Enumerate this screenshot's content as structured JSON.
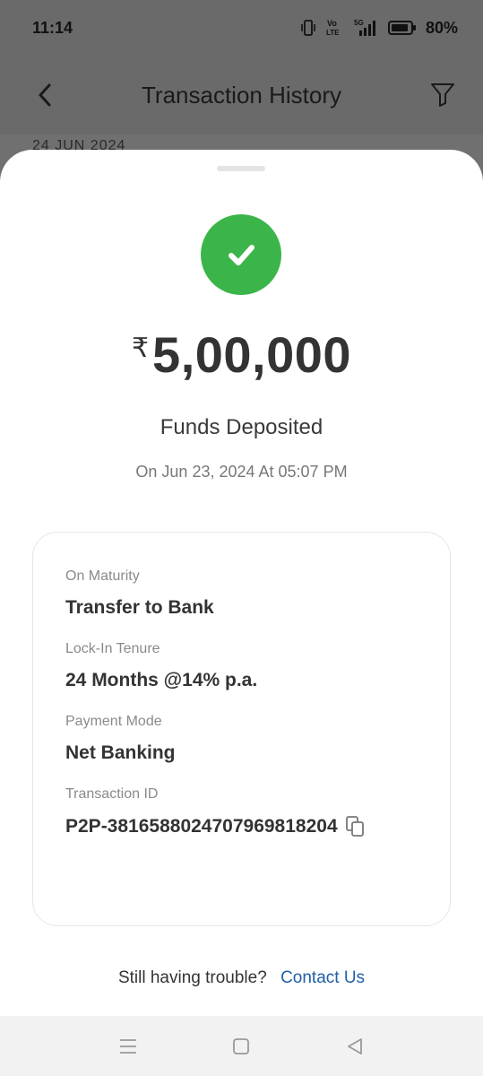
{
  "status_bar": {
    "time": "11:14",
    "battery": "80%",
    "icons": [
      "vibrate-icon",
      "volte-icon",
      "5g-signal-icon",
      "battery-icon"
    ]
  },
  "header": {
    "title": "Transaction History",
    "back_icon": "back-arrow-icon",
    "filter_icon": "filter-icon"
  },
  "list_peek": {
    "date": "24 JUN 2024"
  },
  "transaction": {
    "currency_symbol": "₹",
    "amount": "5,00,000",
    "status": "Funds Deposited",
    "date": "On Jun 23, 2024 At 05:07 PM",
    "status_color": "#3bb54a"
  },
  "details": [
    {
      "label": "On Maturity",
      "value": "Transfer to Bank"
    },
    {
      "label": "Lock-In Tenure",
      "value": "24 Months @14% p.a."
    },
    {
      "label": "Payment Mode",
      "value": "Net Banking"
    },
    {
      "label": "Transaction ID",
      "value": "P2P-381658802470796981820​4"
    }
  ],
  "help": {
    "prompt": "Still having trouble?",
    "link": "Contact Us",
    "link_color": "#1f5fa8"
  },
  "nav": {
    "icons": [
      "recents-icon",
      "home-icon",
      "back-icon"
    ]
  }
}
